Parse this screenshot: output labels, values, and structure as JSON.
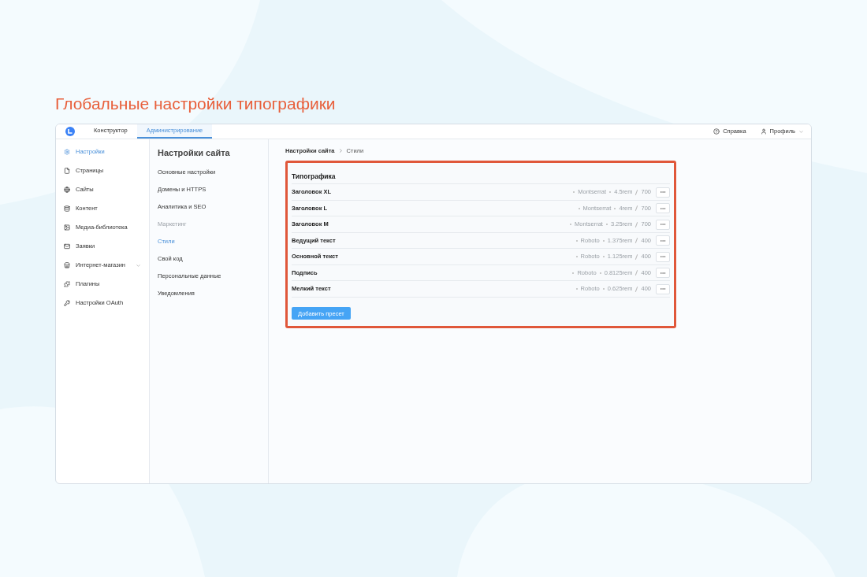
{
  "heading": "Глобальные настройки типографики",
  "tabs": [
    {
      "label": "Конструктор",
      "selected": false
    },
    {
      "label": "Администрирование",
      "selected": true
    }
  ],
  "top_links": [
    {
      "kind": "help",
      "label": "Справка"
    },
    {
      "kind": "profile",
      "label": "Профиль"
    }
  ],
  "sidebar": {
    "items": [
      {
        "kind": "gear",
        "label": "Настройки",
        "selected": true
      },
      {
        "kind": "file",
        "label": "Страницы",
        "selected": false
      },
      {
        "kind": "globe",
        "label": "Сайты",
        "selected": false
      },
      {
        "kind": "db",
        "label": "Контент",
        "selected": false
      },
      {
        "kind": "image",
        "label": "Медиа-библиотека",
        "selected": false
      },
      {
        "kind": "mail",
        "label": "Заявки",
        "selected": false
      },
      {
        "kind": "store",
        "label": "Интернет-магазин",
        "selected": false,
        "expandable": true
      },
      {
        "kind": "puzzle",
        "label": "Плагины",
        "selected": false
      },
      {
        "kind": "key",
        "label": "Настройки OAuth",
        "selected": false
      }
    ]
  },
  "subnav": {
    "title": "Настройки сайта",
    "items": [
      {
        "label": "Основные настройки",
        "selected": false,
        "disabled": false
      },
      {
        "label": "Домены и HTTPS",
        "selected": false,
        "disabled": false
      },
      {
        "label": "Аналитика и SEO",
        "selected": false,
        "disabled": false
      },
      {
        "label": "Маркетинг",
        "selected": false,
        "disabled": true
      },
      {
        "label": "Стили",
        "selected": true,
        "disabled": false
      },
      {
        "label": "Свой код",
        "selected": false,
        "disabled": false
      },
      {
        "label": "Персональные данные",
        "selected": false,
        "disabled": false
      },
      {
        "label": "Уведомления",
        "selected": false,
        "disabled": false
      }
    ]
  },
  "breadcrumb": [
    "Настройки сайта",
    "Стили"
  ],
  "card": {
    "title": "Типографика",
    "highlighted": true,
    "rows": [
      {
        "name": "Заголовок XL",
        "font": "Montserrat",
        "size": "4.5rem",
        "weight": "700"
      },
      {
        "name": "Заголовок L",
        "font": "Montserrat",
        "size": "4rem",
        "weight": "700"
      },
      {
        "name": "Заголовок M",
        "font": "Montserrat",
        "size": "3.25rem",
        "weight": "700"
      },
      {
        "name": "Ведущий текст",
        "font": "Roboto",
        "size": "1.375rem",
        "weight": "400"
      },
      {
        "name": "Основной текст",
        "font": "Roboto",
        "size": "1.125rem",
        "weight": "400"
      },
      {
        "name": "Подпись",
        "font": "Roboto",
        "size": "0.8125rem",
        "weight": "400"
      },
      {
        "name": "Мелкий текст",
        "font": "Roboto",
        "size": "0.625rem",
        "weight": "400"
      }
    ],
    "button": "Добавить пресет"
  }
}
